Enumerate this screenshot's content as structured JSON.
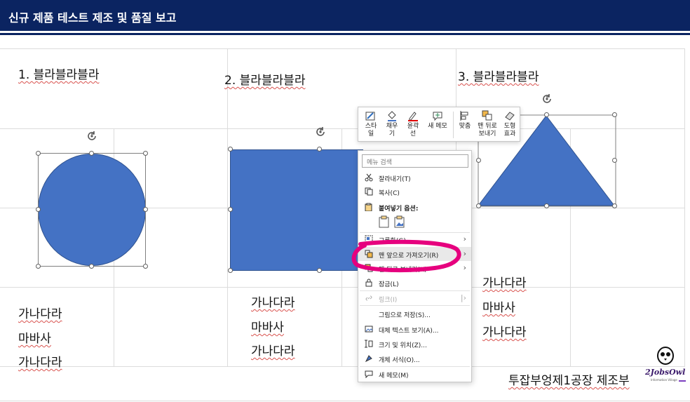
{
  "slide": {
    "title": "신규 제품 테스트 제조 및 품질 보고",
    "headings": [
      "1.  블라블라블라",
      "2. 블라블라블라",
      "3. 블라블라블라"
    ],
    "col1_lines": [
      "가나다라",
      "마바사",
      "가나다라"
    ],
    "col2_lines": [
      "가나다라",
      "마바사",
      "가나다라"
    ],
    "col3_lines": [
      "가나다라",
      "마바사",
      "가나다라"
    ],
    "footer": "투잡부엉제1공장 제조부"
  },
  "mini_toolbar": {
    "items": [
      {
        "label": "스타\n일",
        "icon": "style-icon"
      },
      {
        "label": "채우\n기",
        "icon": "fill-bucket-icon"
      },
      {
        "label": "윤곽\n선",
        "icon": "outline-pen-icon"
      },
      {
        "label": "새 메모",
        "icon": "new-comment-icon"
      },
      {
        "label": "맞춤",
        "icon": "align-icon"
      },
      {
        "label": "맨 뒤로\n보내기",
        "icon": "send-to-back-icon"
      },
      {
        "label": "도형\n효과",
        "icon": "shape-effects-icon"
      }
    ]
  },
  "context_menu": {
    "search_placeholder": "메뉴 검색",
    "cut": "잘라내기(T)",
    "copy": "복사(C)",
    "paste_options": "붙여넣기 옵션:",
    "group": "그룹화(G)",
    "bring_to_front": "맨 앞으로 가져오기(R)",
    "send_to_back": "맨 뒤로 보내기(K)",
    "lock": "잠금(L)",
    "link": "링크(I)",
    "save_as_picture": "그림으로 저장(S)...",
    "alt_text": "대체 텍스트 보기(A)...",
    "size_position": "크기 및 위치(Z)...",
    "format_object": "개체 서식(O)...",
    "new_comment": "새 메모(M)"
  },
  "colors": {
    "title_bar": "#0b2461",
    "shape_fill": "#4472c4",
    "annotation": "#e6007e"
  },
  "logo": {
    "text": "2JobsOwl",
    "sub": "Information Village"
  }
}
